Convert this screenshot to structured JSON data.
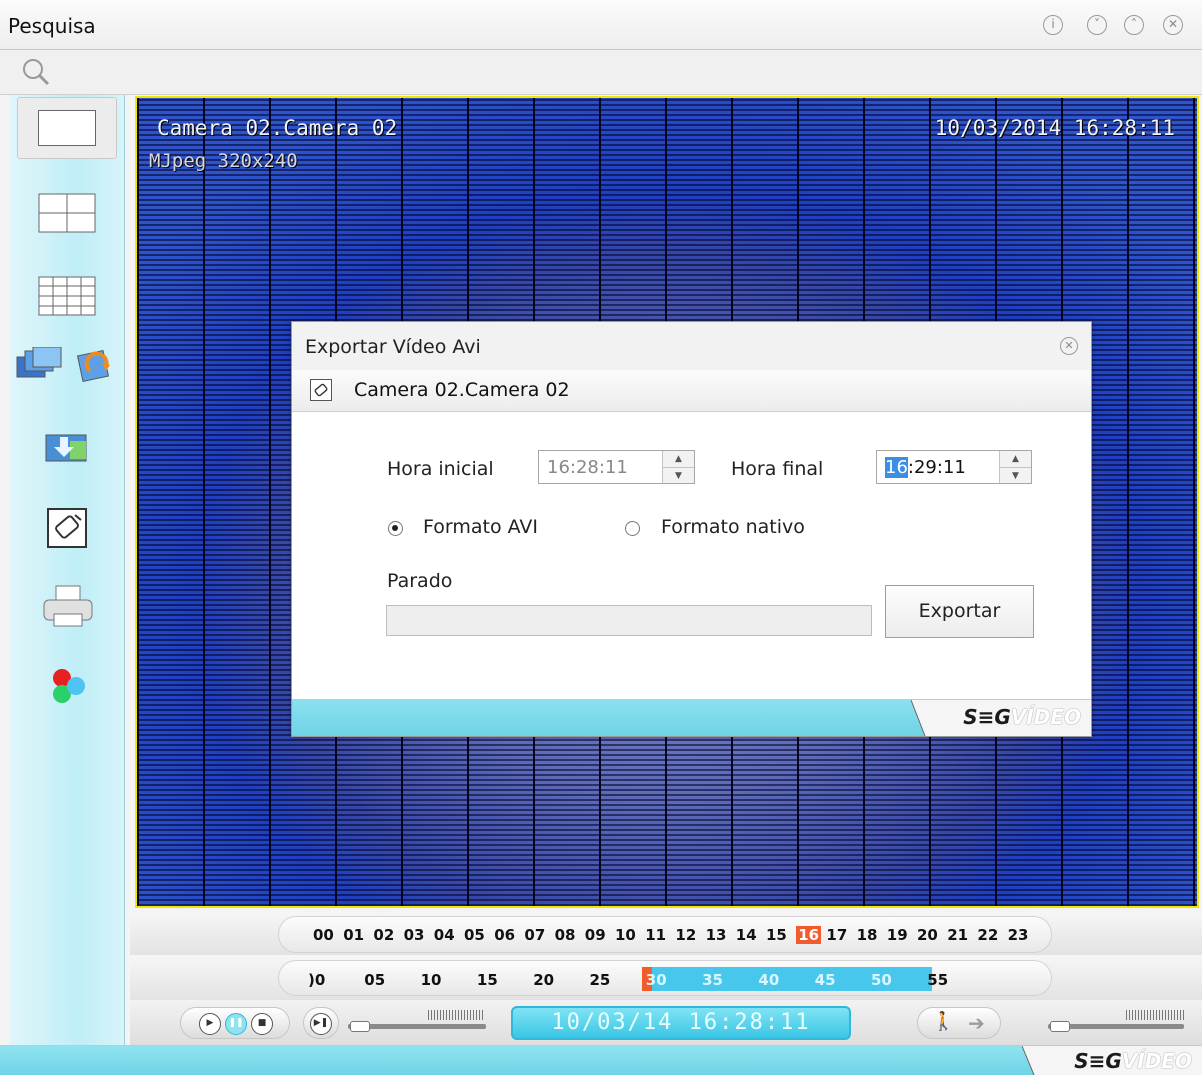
{
  "window": {
    "title": "Pesquisa"
  },
  "video": {
    "camera_name": "Camera 02.Camera 02",
    "stream_format": "MJpeg 320x240",
    "datetime": "10/03/2014 16:28:11"
  },
  "dialog": {
    "title": "Exportar Vídeo Avi",
    "camera_label": "Camera 02.Camera 02",
    "start_time_label": "Hora inicial",
    "start_time_value": "16:28:11",
    "end_time_label": "Hora final",
    "end_time_hour": "16",
    "end_time_rest": ":29:11",
    "format_avi_label": "Formato AVI",
    "format_native_label": "Formato nativo",
    "selected_format": "avi",
    "status_text": "Parado",
    "progress": 0,
    "export_button": "Exportar"
  },
  "brand": {
    "part1": "S≡G",
    "part2": "VÍDEO"
  },
  "timeline": {
    "hours": [
      "00",
      "01",
      "02",
      "03",
      "04",
      "05",
      "06",
      "07",
      "08",
      "09",
      "10",
      "11",
      "12",
      "13",
      "14",
      "15",
      "16",
      "17",
      "18",
      "19",
      "20",
      "21",
      "22",
      "23"
    ],
    "current_hour": "16",
    "minutes": [
      "00",
      "05",
      "10",
      "15",
      "20",
      "25",
      "30",
      "35",
      "40",
      "45",
      "50",
      "55"
    ],
    "minutes_display": [
      ")0",
      "05",
      "10",
      "15",
      "20",
      "25",
      "30",
      "35",
      "40",
      "45",
      "50",
      "55"
    ],
    "recorded_from": "30",
    "recorded_to": "50",
    "clock": "10/03/14  16:28:11"
  },
  "colors": {
    "accent": "#48c7ec",
    "current_marker": "#f25b2b",
    "frame_border": "#f2e500"
  },
  "icons": [
    "search-icon",
    "layout-single-icon",
    "layout-quad-icon",
    "layout-grid-icon",
    "monitors-icon",
    "refresh-icon",
    "download-icon",
    "export-avi-icon",
    "print-icon",
    "colors-icon",
    "play-icon",
    "pause-icon",
    "stop-icon",
    "step-icon",
    "motion-icon",
    "arrow-right-icon"
  ]
}
